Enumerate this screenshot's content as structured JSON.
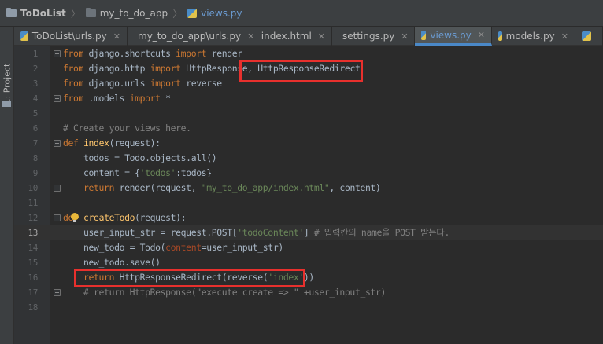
{
  "breadcrumb": {
    "project": "ToDoList",
    "folder": "my_to_do_app",
    "file": "views.py"
  },
  "toolstrip": {
    "project_label": "1: Project"
  },
  "tabs": [
    {
      "label": "ToDoList\\urls.py",
      "icon": "python-icon",
      "active": false
    },
    {
      "label": "my_to_do_app\\urls.py",
      "icon": "python-icon",
      "active": false
    },
    {
      "label": "index.html",
      "icon": "html-icon",
      "active": false
    },
    {
      "label": "settings.py",
      "icon": "python-icon",
      "active": false
    },
    {
      "label": "views.py",
      "icon": "python-icon",
      "active": true
    },
    {
      "label": "models.py",
      "icon": "python-icon",
      "active": false
    },
    {
      "label": "",
      "icon": "python-icon",
      "active": false
    }
  ],
  "editor": {
    "current_line": 13,
    "lines": [
      {
        "n": "1",
        "t": "from django.shortcuts import render"
      },
      {
        "n": "2",
        "t": "from django.http import HttpResponse, HttpResponseRedirect"
      },
      {
        "n": "3",
        "t": "from django.urls import reverse"
      },
      {
        "n": "4",
        "t": "from .models import *"
      },
      {
        "n": "5",
        "t": ""
      },
      {
        "n": "6",
        "t": "# Create your views here."
      },
      {
        "n": "7",
        "t": "def index(request):"
      },
      {
        "n": "8",
        "t": "    todos = Todo.objects.all()"
      },
      {
        "n": "9",
        "t": "    content = {'todos':todos}"
      },
      {
        "n": "10",
        "t": "    return render(request, \"my_to_do_app/index.html\", content)"
      },
      {
        "n": "11",
        "t": ""
      },
      {
        "n": "12",
        "t": "def createTodo(request):"
      },
      {
        "n": "13",
        "t": "    user_input_str = request.POST['todoContent'] # 입력칸의 name을 POST 받는다."
      },
      {
        "n": "14",
        "t": "    new_todo = Todo(content=user_input_str)"
      },
      {
        "n": "15",
        "t": "    new_todo.save()"
      },
      {
        "n": "16",
        "t": "    return HttpResponseRedirect(reverse('index'))"
      },
      {
        "n": "17",
        "t": "    # return HttpResponse(\"execute create => \" +user_input_str)"
      },
      {
        "n": "18",
        "t": ""
      }
    ]
  },
  "colors": {
    "keyword": "#cc7832",
    "string": "#6a8759",
    "comment": "#808080",
    "function_name": "#ffc66d",
    "named_param": "#aa4926",
    "annotation_box": "#e8302d",
    "active_tab_accent": "#4a88c7"
  }
}
